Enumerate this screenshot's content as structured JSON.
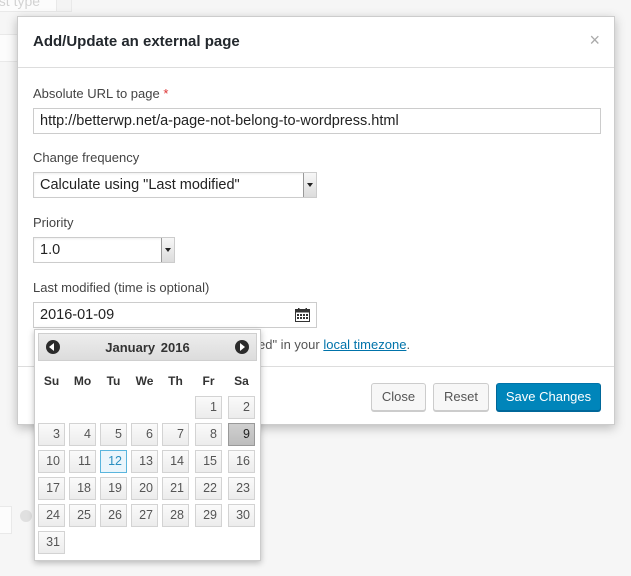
{
  "background": {
    "post_type_placeholder": "ost type"
  },
  "modal": {
    "title": "Add/Update an external page",
    "close_glyph": "×",
    "url": {
      "label": "Absolute URL to page",
      "required_mark": "*",
      "value": "http://betterwp.net/a-page-not-belong-to-wordpress.html"
    },
    "frequency": {
      "label": "Change frequency",
      "selected": "Calculate using \"Last modified\""
    },
    "priority": {
      "label": "Priority",
      "selected": "1.0"
    },
    "last_modified": {
      "label": "Last modified (time is optional)",
      "value": "2016-01-09",
      "hint_prefix": "ed\" in your ",
      "hint_link": "local timezone",
      "hint_suffix": "."
    },
    "footer": {
      "close_label": "Close",
      "reset_label": "Reset",
      "save_label": "Save Changes"
    }
  },
  "datepicker": {
    "month": "January",
    "year": "2016",
    "weekdays": [
      "Su",
      "Mo",
      "Tu",
      "We",
      "Th",
      "Fr",
      "Sa"
    ],
    "weeks": [
      [
        "",
        "",
        "",
        "",
        "",
        "1",
        "2"
      ],
      [
        "3",
        "4",
        "5",
        "6",
        "7",
        "8",
        "9"
      ],
      [
        "10",
        "11",
        "12",
        "13",
        "14",
        "15",
        "16"
      ],
      [
        "17",
        "18",
        "19",
        "20",
        "21",
        "22",
        "23"
      ],
      [
        "24",
        "25",
        "26",
        "27",
        "28",
        "29",
        "30"
      ],
      [
        "31",
        "",
        "",
        "",
        "",
        "",
        ""
      ]
    ],
    "today": "12",
    "selected": "9"
  },
  "icons": {
    "close": "close-icon",
    "calendar": "calendar-icon",
    "prev": "arrow-left-icon",
    "next": "arrow-right-icon"
  },
  "colors": {
    "primary_button": "#0085ba",
    "link": "#0073aa",
    "required": "#dc3232"
  }
}
